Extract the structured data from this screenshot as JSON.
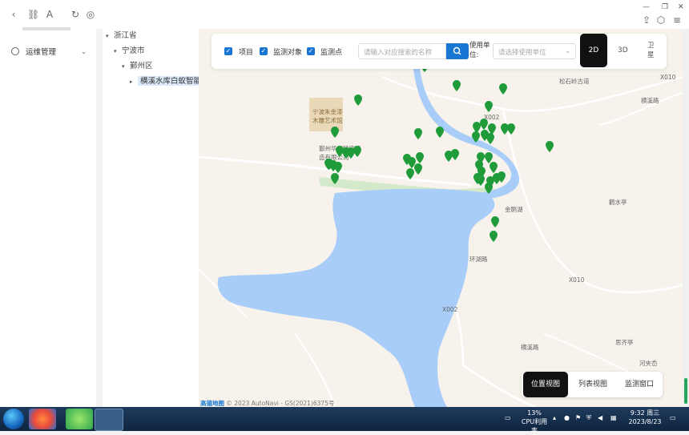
{
  "sidebar": {
    "items": [
      {
        "label": "运维管理"
      }
    ]
  },
  "tree": {
    "province": "浙江省",
    "city": "宁波市",
    "district": "鄞州区",
    "project": "横溪水库白蚁智能监测"
  },
  "toolbar": {
    "check_project": "项目",
    "check_object": "监测对象",
    "check_point": "监测点",
    "search_placeholder": "请输入对应搜索的名称",
    "unit_label": "使用单位:",
    "unit_placeholder": "请选择使用单位",
    "mode_2d": "2D",
    "mode_3d": "3D",
    "mode_sat": "卫星"
  },
  "views": {
    "position": "位置视图",
    "list": "列表视图",
    "window": "监测窗口"
  },
  "map_labels": {
    "museum": "宁波朱金漆木雕艺术馆",
    "songshiling": "松石岭古道",
    "road_x002a": "X002",
    "road_x002b": "X002",
    "road_x010a": "X010",
    "road_x010b": "X010",
    "jinehu": "金鹅湖",
    "pavilion1": "鹳水亭",
    "pavilion2": "思齐亭",
    "company": "鄞州华兴精密铸造有限公司",
    "road1": "横溪路",
    "road2": "环湖路",
    "road3": "横溪路",
    "village": "河夹岙",
    "copyright": "© 2023 AutoNavi - GS(2021)6375号",
    "amap": "高德地图"
  },
  "taskbar": {
    "cpu_percent": "13%",
    "cpu_label": "CPU利用率",
    "time": "9:32 周三",
    "date": "2023/8/23"
  },
  "colors": {
    "accent": "#1976d2",
    "marker": "#1f9b3a",
    "water": "#a8cdf9",
    "land": "#f7f3ec"
  }
}
